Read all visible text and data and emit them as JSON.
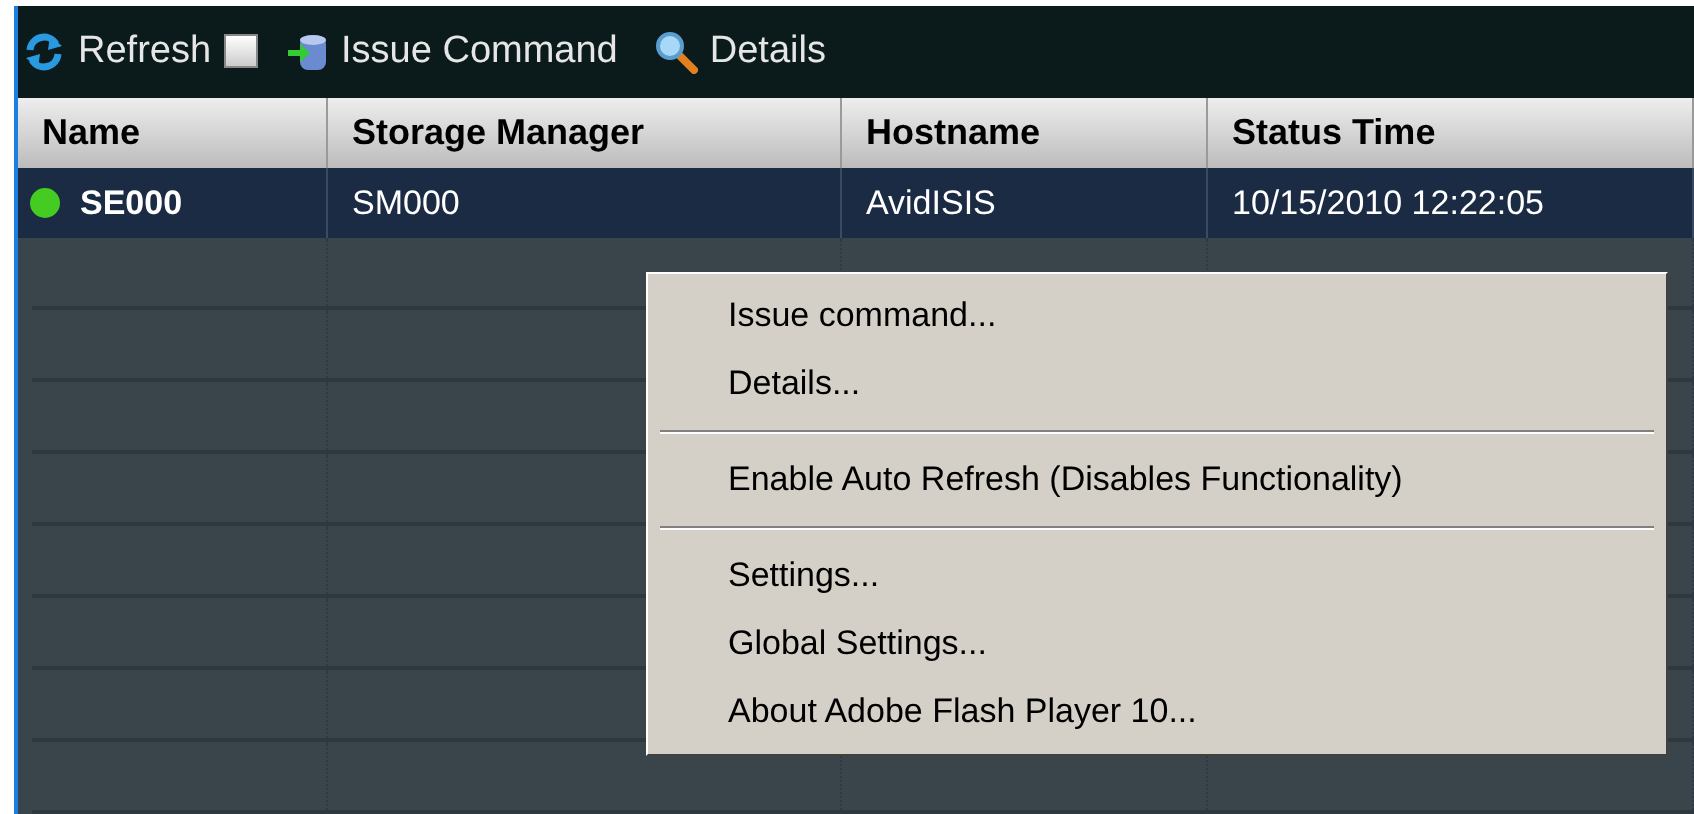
{
  "toolbar": {
    "refresh": {
      "label": "Refresh"
    },
    "auto_refresh": {
      "checked": false
    },
    "issue_command": {
      "label": "Issue Command"
    },
    "details": {
      "label": "Details"
    }
  },
  "table": {
    "columns": [
      "Name",
      "Storage Manager",
      "Hostname",
      "Status Time"
    ],
    "rows": [
      {
        "name": "SE000",
        "color": "#44cc22",
        "storage_manager": "SM000",
        "hostname": "AvidISIS",
        "status_time": "10/15/2010 12:22:05",
        "selected": true
      }
    ]
  },
  "context_menu": {
    "items": [
      {
        "kind": "item",
        "label": "Issue command..."
      },
      {
        "kind": "item",
        "label": "Details..."
      },
      {
        "kind": "separator"
      },
      {
        "kind": "item",
        "label": "Enable Auto Refresh (Disables Functionality)"
      },
      {
        "kind": "separator"
      },
      {
        "kind": "item",
        "label": "Settings..."
      },
      {
        "kind": "item",
        "label": "Global Settings..."
      },
      {
        "kind": "item",
        "label": "About Adobe Flash Player 10..."
      }
    ]
  }
}
